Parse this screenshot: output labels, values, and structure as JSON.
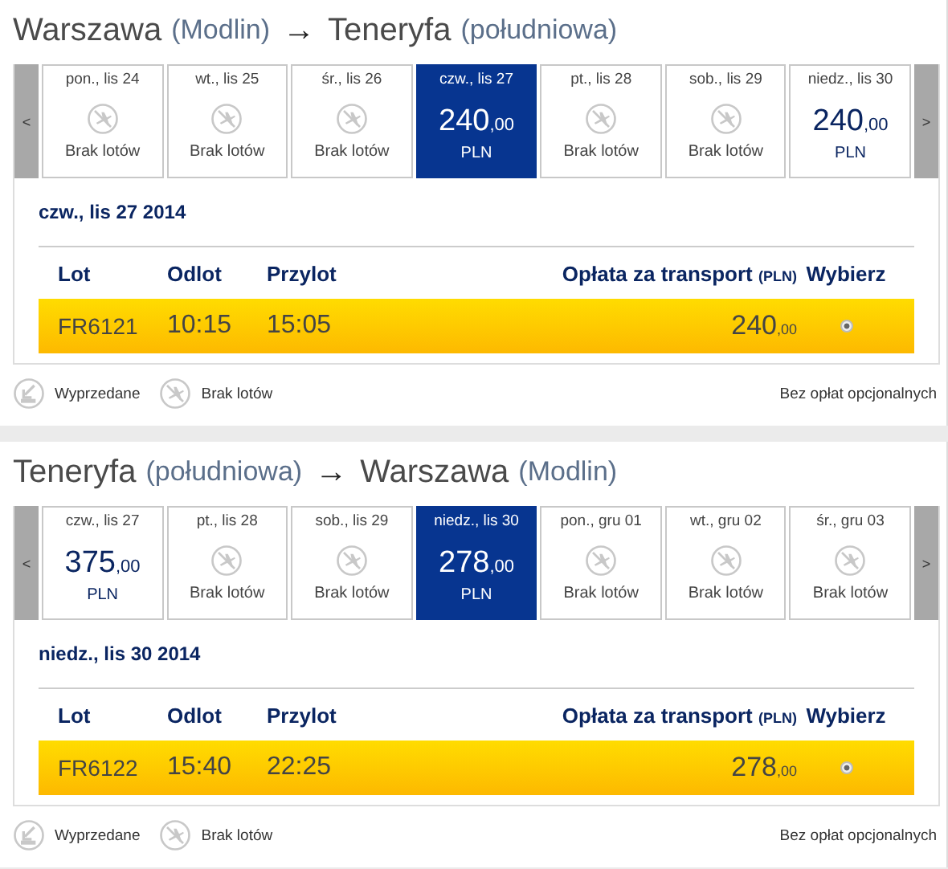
{
  "journeys": [
    {
      "title": {
        "origin": "Warszawa",
        "origin_airport": "(Modlin)",
        "arrow": "→",
        "destination": "Teneryfa",
        "destination_airport": "(południowa)"
      },
      "prev": "<",
      "next": ">",
      "days": [
        {
          "label": "pon., lis 24",
          "kind": "none",
          "status": "Brak lotów",
          "selected": false
        },
        {
          "label": "wt., lis 25",
          "kind": "none",
          "status": "Brak lotów",
          "selected": false
        },
        {
          "label": "śr., lis 26",
          "kind": "none",
          "status": "Brak lotów",
          "selected": false
        },
        {
          "label": "czw., lis 27",
          "kind": "price",
          "price": "240",
          "cents": ",00",
          "currency": "PLN",
          "selected": true
        },
        {
          "label": "pt., lis 28",
          "kind": "none",
          "status": "Brak lotów",
          "selected": false
        },
        {
          "label": "sob., lis 29",
          "kind": "none",
          "status": "Brak lotów",
          "selected": false
        },
        {
          "label": "niedz., lis 30",
          "kind": "price",
          "price": "240",
          "cents": ",00",
          "currency": "PLN",
          "selected": false
        }
      ],
      "date_heading": "czw., lis 27 2014",
      "columns": {
        "flight": "Lot",
        "departure": "Odlot",
        "arrival": "Przylot",
        "fare": "Opłata za transport",
        "fare_unit": "(PLN)",
        "select": "Wybierz"
      },
      "flights": [
        {
          "number": "FR6121",
          "departure": "10:15",
          "arrival": "15:05",
          "price": "240",
          "cents": ",00",
          "selected": true
        }
      ],
      "legend": [
        {
          "kind": "sold_out",
          "label": "Wyprzedane"
        },
        {
          "kind": "no_flights",
          "label": "Brak lotów"
        }
      ],
      "note": "Bez opłat opcjonalnych"
    },
    {
      "title": {
        "origin": "Teneryfa",
        "origin_airport": "(południowa)",
        "arrow": "→",
        "destination": "Warszawa",
        "destination_airport": "(Modlin)"
      },
      "prev": "<",
      "next": ">",
      "days": [
        {
          "label": "czw., lis 27",
          "kind": "price",
          "price": "375",
          "cents": ",00",
          "currency": "PLN",
          "selected": false
        },
        {
          "label": "pt., lis 28",
          "kind": "none",
          "status": "Brak lotów",
          "selected": false
        },
        {
          "label": "sob., lis 29",
          "kind": "none",
          "status": "Brak lotów",
          "selected": false
        },
        {
          "label": "niedz., lis 30",
          "kind": "price",
          "price": "278",
          "cents": ",00",
          "currency": "PLN",
          "selected": true
        },
        {
          "label": "pon., gru 01",
          "kind": "none",
          "status": "Brak lotów",
          "selected": false
        },
        {
          "label": "wt., gru 02",
          "kind": "none",
          "status": "Brak lotów",
          "selected": false
        },
        {
          "label": "śr., gru 03",
          "kind": "none",
          "status": "Brak lotów",
          "selected": false
        }
      ],
      "date_heading": "niedz., lis 30 2014",
      "columns": {
        "flight": "Lot",
        "departure": "Odlot",
        "arrival": "Przylot",
        "fare": "Opłata za transport",
        "fare_unit": "(PLN)",
        "select": "Wybierz"
      },
      "flights": [
        {
          "number": "FR6122",
          "departure": "15:40",
          "arrival": "22:25",
          "price": "278",
          "cents": ",00",
          "selected": true
        }
      ],
      "legend": [
        {
          "kind": "sold_out",
          "label": "Wyprzedane"
        },
        {
          "kind": "no_flights",
          "label": "Brak lotów"
        }
      ],
      "note": "Bez opłat opcjonalnych"
    }
  ]
}
